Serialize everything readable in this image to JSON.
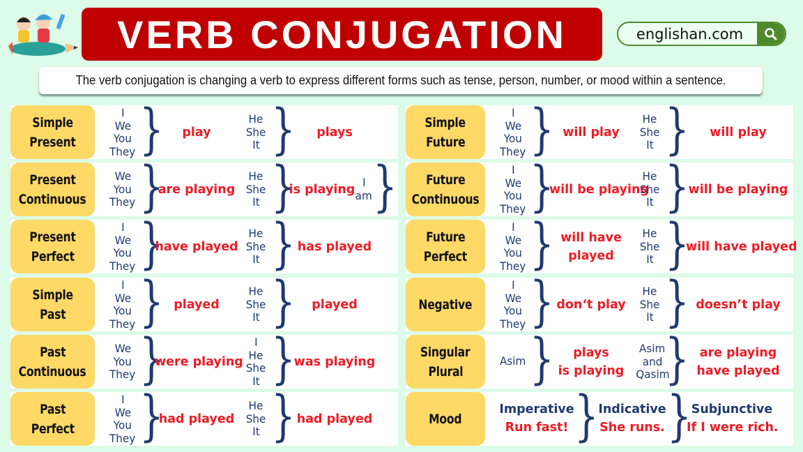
{
  "header": {
    "title": "VERB CONJUGATION",
    "site": "englishan.com",
    "search_icon": "search-icon",
    "logo": "kids-riding-pencil-illustration"
  },
  "definition": "The verb conjugation is changing a verb to express different forms such as tense, person, number, or mood within a sentence.",
  "colors": {
    "background": "#dcfbe9",
    "title_banner": "#c00000",
    "label_box": "#ffd966",
    "pronoun_text": "#1f3a6e",
    "verb_text": "#ee1c25",
    "site_accent": "#4e8a2b"
  },
  "left_rows": [
    {
      "label": [
        "Simple",
        "Present"
      ],
      "group1": [
        "I",
        "We",
        "You",
        "They"
      ],
      "verb1": [
        "play"
      ],
      "group2": [
        "He",
        "She",
        "It"
      ],
      "verb2": [
        "plays"
      ]
    },
    {
      "label": [
        "Present",
        "Continuous"
      ],
      "group1": [
        "We",
        "You",
        "They"
      ],
      "verb1": [
        "are playing"
      ],
      "group2": [
        "He",
        "She",
        "It"
      ],
      "verb2": [
        "is playing"
      ],
      "group3": [
        "I",
        "am"
      ]
    },
    {
      "label": [
        "Present",
        "Perfect"
      ],
      "group1": [
        "I",
        "We",
        "You",
        "They"
      ],
      "verb1": [
        "have played"
      ],
      "group2": [
        "He",
        "She",
        "It"
      ],
      "verb2": [
        "has played"
      ]
    },
    {
      "label": [
        "Simple",
        "Past"
      ],
      "group1": [
        "I",
        "We",
        "You",
        "They"
      ],
      "verb1": [
        "played"
      ],
      "group2": [
        "He",
        "She",
        "It"
      ],
      "verb2": [
        "played"
      ]
    },
    {
      "label": [
        "Past",
        "Continuous"
      ],
      "group1": [
        "We",
        "You",
        "They"
      ],
      "verb1": [
        "were playing"
      ],
      "group2": [
        "I",
        "He",
        "She",
        "It"
      ],
      "verb2": [
        "was playing"
      ]
    },
    {
      "label": [
        "Past",
        "Perfect"
      ],
      "group1": [
        "I",
        "We",
        "You",
        "They"
      ],
      "verb1": [
        "had played"
      ],
      "group2": [
        "He",
        "She",
        "It"
      ],
      "verb2": [
        "had played"
      ]
    }
  ],
  "right_rows": [
    {
      "label": [
        "Simple",
        "Future"
      ],
      "group1": [
        "I",
        "We",
        "You",
        "They"
      ],
      "verb1": [
        "will play"
      ],
      "group2": [
        "He",
        "She",
        "It"
      ],
      "verb2": [
        "will play"
      ]
    },
    {
      "label": [
        "Future",
        "Continuous"
      ],
      "group1": [
        "I",
        "We",
        "You",
        "They"
      ],
      "verb1": [
        "will be playing"
      ],
      "group2": [
        "He",
        "She",
        "It"
      ],
      "verb2": [
        "will be playing"
      ]
    },
    {
      "label": [
        "Future",
        "Perfect"
      ],
      "group1": [
        "I",
        "We",
        "You",
        "They"
      ],
      "verb1": [
        "will have",
        "played"
      ],
      "group2": [
        "He",
        "She",
        "It"
      ],
      "verb2": [
        "will have played"
      ]
    },
    {
      "label": [
        "Negative"
      ],
      "group1": [
        "I",
        "We",
        "You",
        "They"
      ],
      "verb1": [
        "don‘t play"
      ],
      "group2": [
        "He",
        "She",
        "It"
      ],
      "verb2": [
        "doesn’t play"
      ]
    },
    {
      "label": [
        "Singular",
        "Plural"
      ],
      "group1": [
        "Asim"
      ],
      "verb1": [
        "plays",
        "is playing"
      ],
      "group2": [
        "Asim",
        "and",
        "Qasim"
      ],
      "verb2": [
        "are playing",
        "have played"
      ]
    },
    {
      "label": [
        "Mood"
      ],
      "moods": [
        {
          "name": "Imperative",
          "example": "Run fast!"
        },
        {
          "name": "Indicative",
          "example": "She runs."
        },
        {
          "name": "Subjunctive",
          "example": "If I were rich."
        }
      ]
    }
  ]
}
